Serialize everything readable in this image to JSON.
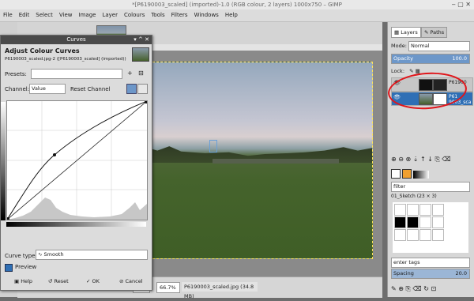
{
  "window_title": "*[P6190003_scaled] (imported)-1.0 (RGB colour, 2 layers) 1000x750 – GIMP",
  "menu": [
    "File",
    "Edit",
    "Select",
    "View",
    "Image",
    "Layer",
    "Colours",
    "Tools",
    "Filters",
    "Windows",
    "Help"
  ],
  "curves_dialog": {
    "title": "Curves",
    "heading": "Adjust Colour Curves",
    "subtitle": "P6190003_scaled.jpg-2 ([P6190003_scaled] (imported))",
    "presets_label": "Presets:",
    "channel_label": "Channel:",
    "channel_value": "Value",
    "reset_channel": "Reset Channel",
    "curve_type_label": "Curve type:",
    "curve_type_value": "Smooth",
    "preview_label": "Preview",
    "help": "Help",
    "reset": "Reset",
    "ok": "OK",
    "cancel": "Cancel"
  },
  "statusbar": {
    "unit": "px",
    "zoom": "66.7%",
    "filename": "P6190003_scaled.jpg (34.8 MB)"
  },
  "layers_dock": {
    "tab_layers": "Layers",
    "tab_paths": "Paths",
    "mode_label": "Mode:",
    "mode_value": "Normal",
    "opacity_label": "Opacity",
    "opacity_value": "100.0",
    "lock_label": "Lock:",
    "layers": [
      {
        "name": "P61900"
      },
      {
        "name": "P61 9003_sca"
      }
    ],
    "filter_label": "filter",
    "brush_name": "01_Sketch (23 × 3)",
    "tags_label": "enter tags",
    "spacing_label": "Spacing",
    "spacing_value": "20.0"
  },
  "colors": {
    "accent": "#2f6fb5",
    "annotation": "#e0151a"
  }
}
